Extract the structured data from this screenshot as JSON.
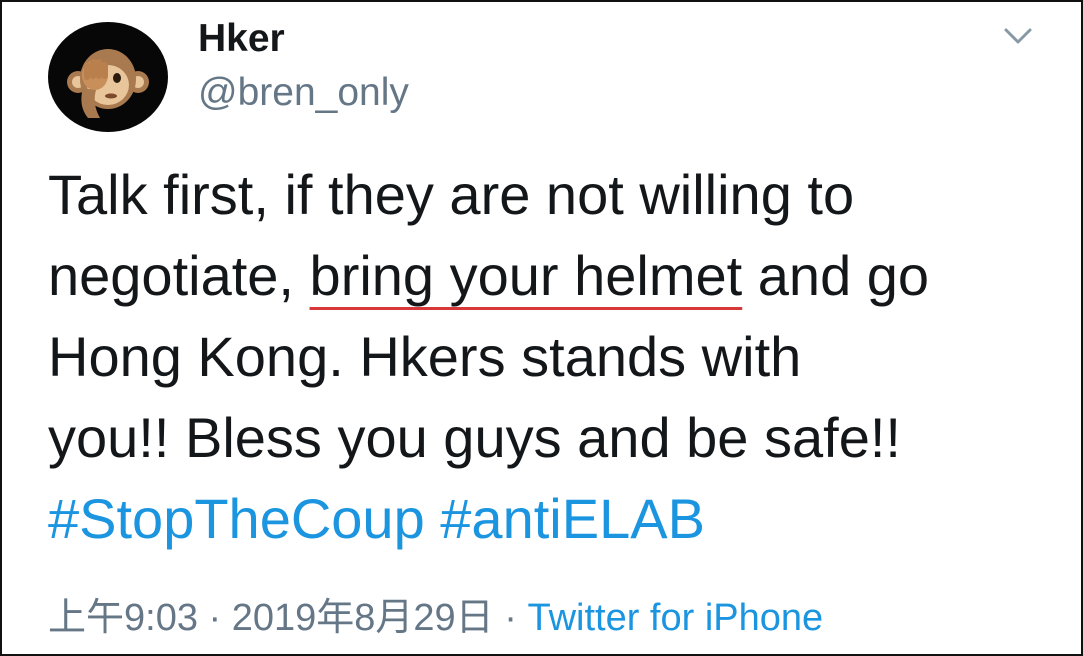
{
  "tweet": {
    "display_name": "Hker",
    "handle": "@bren_only",
    "avatar_icon": "see-no-evil-monkey-emoji-icon",
    "menu_icon": "chevron-down-icon",
    "text": {
      "line1": "Talk first, if they are not willing to",
      "line2_before": "negotiate, ",
      "line2_highlight": "bring your helmet",
      "line2_after": " and go",
      "line3": "Hong Kong. Hkers stands with",
      "line4": "you!! Bless you guys and be safe!!",
      "hashtag1": "#StopTheCoup",
      "hashtag2": "#antiELAB"
    },
    "time": "上午9:03",
    "separator": " · ",
    "date": "2019年8月29日",
    "source": "Twitter for iPhone"
  },
  "colors": {
    "text": "#14171a",
    "secondary": "#657786",
    "link": "#1b95e0",
    "underline_annotation": "#d9383a",
    "border": "#111111"
  }
}
